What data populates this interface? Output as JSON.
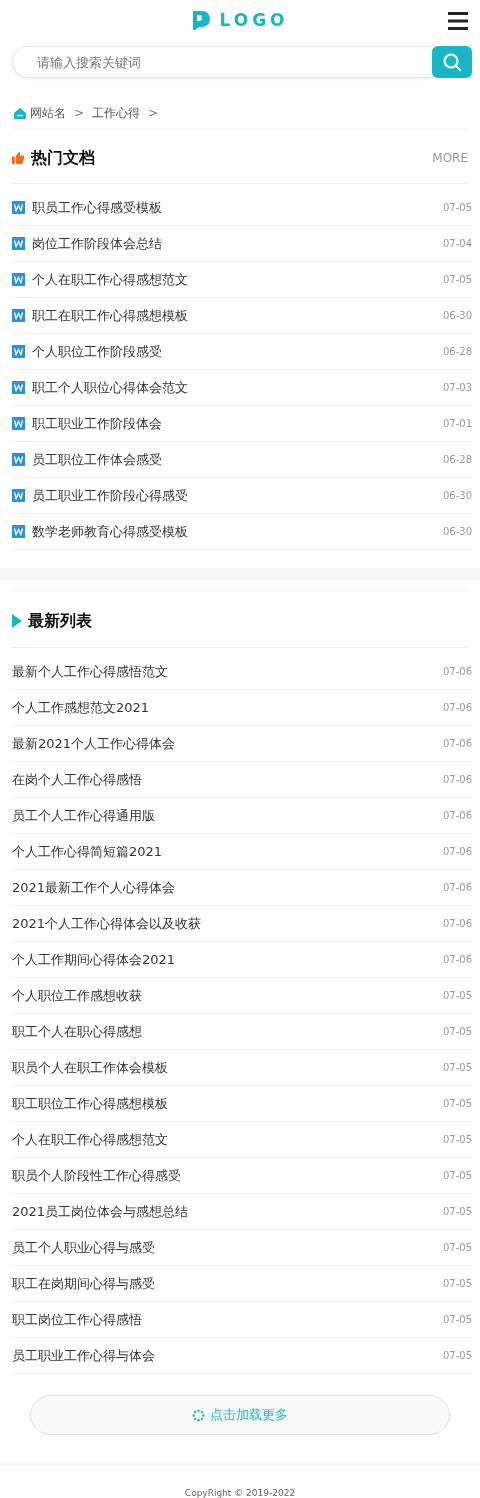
{
  "header": {
    "logo": "LOGO"
  },
  "search": {
    "placeholder": "请输入搜索关键词"
  },
  "breadcrumb": [
    "网站名",
    ">",
    "工作心得",
    ">"
  ],
  "hot": {
    "title": "热门文档",
    "more": "MORE",
    "items": [
      {
        "title": "职员工作心得感受模板",
        "date": "07-05"
      },
      {
        "title": "岗位工作阶段体会总结",
        "date": "07-04"
      },
      {
        "title": "个人在职工作心得感想范文",
        "date": "07-05"
      },
      {
        "title": "职工在职工作心得感想模板",
        "date": "06-30"
      },
      {
        "title": "个人职位工作阶段感受",
        "date": "06-28"
      },
      {
        "title": "职工个人职位心得体会范文",
        "date": "07-03"
      },
      {
        "title": "职工职业工作阶段体会",
        "date": "07-01"
      },
      {
        "title": "员工职位工作体会感受",
        "date": "06-28"
      },
      {
        "title": "员工职业工作阶段心得感受",
        "date": "06-30"
      },
      {
        "title": "数学老师教育心得感受模板",
        "date": "06-30"
      }
    ]
  },
  "latest": {
    "title": "最新列表",
    "items": [
      {
        "title": "最新个人工作心得感悟范文",
        "date": "07-06"
      },
      {
        "title": "个人工作感想范文2021",
        "date": "07-06"
      },
      {
        "title": "最新2021个人工作心得体会",
        "date": "07-06"
      },
      {
        "title": "在岗个人工作心得感悟",
        "date": "07-06"
      },
      {
        "title": "员工个人工作心得通用版",
        "date": "07-06"
      },
      {
        "title": "个人工作心得简短篇2021",
        "date": "07-06"
      },
      {
        "title": "2021最新工作个人心得体会",
        "date": "07-06"
      },
      {
        "title": "2021个人工作心得体会以及收获",
        "date": "07-06"
      },
      {
        "title": "个人工作期间心得体会2021",
        "date": "07-06"
      },
      {
        "title": "个人职位工作感想收获",
        "date": "07-05"
      },
      {
        "title": "职工个人在职心得感想",
        "date": "07-05"
      },
      {
        "title": "职员个人在职工作体会模板",
        "date": "07-05"
      },
      {
        "title": "职工职位工作心得感想模板",
        "date": "07-05"
      },
      {
        "title": "个人在职工作心得感想范文",
        "date": "07-05"
      },
      {
        "title": "职员个人阶段性工作心得感受",
        "date": "07-05"
      },
      {
        "title": "2021员工岗位体会与感想总结",
        "date": "07-05"
      },
      {
        "title": "员工个人职业心得与感受",
        "date": "07-05"
      },
      {
        "title": "职工在岗期间心得与感受",
        "date": "07-05"
      },
      {
        "title": "职工岗位工作心得感悟",
        "date": "07-05"
      },
      {
        "title": "员工职业工作心得与体会",
        "date": "07-05"
      }
    ]
  },
  "load_more": "点击加载更多",
  "footer": {
    "copyright": "CopyRight © 2019-2022"
  }
}
